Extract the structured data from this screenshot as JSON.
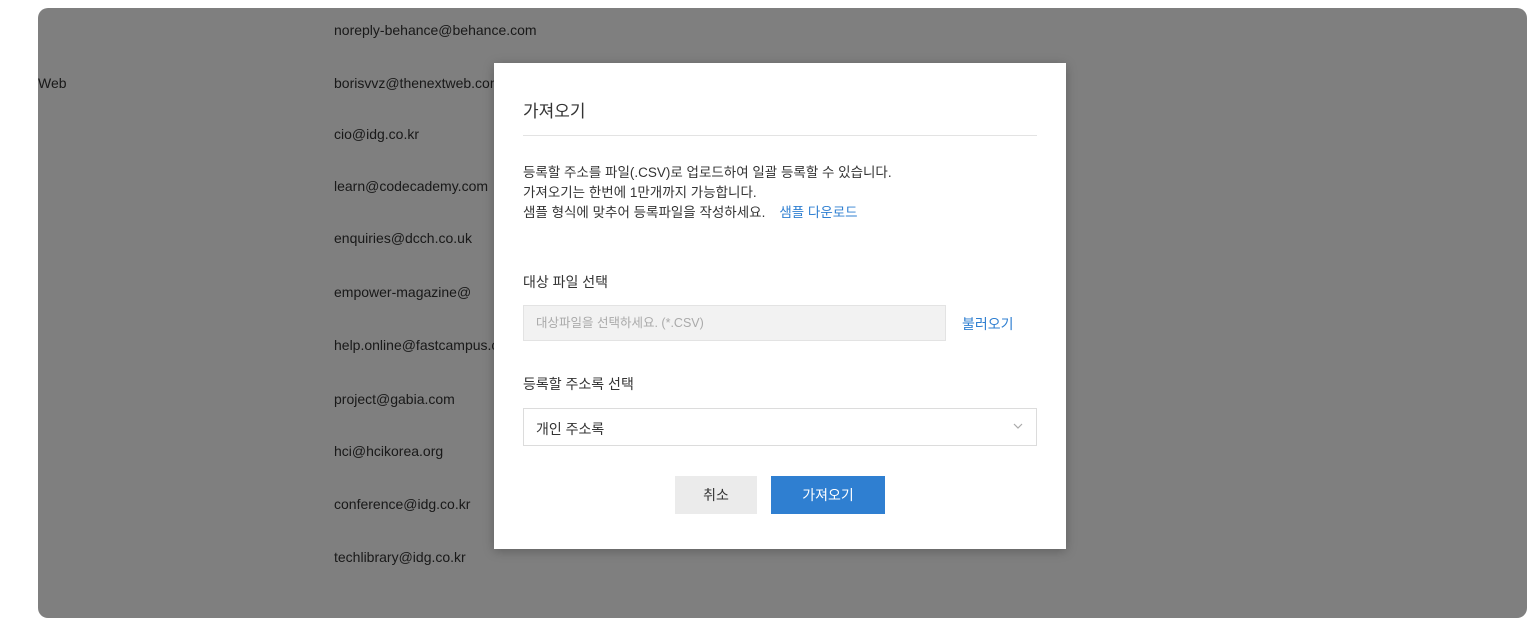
{
  "background": {
    "rows": [
      {
        "category": "",
        "email": "noreply-behance@behance.com"
      },
      {
        "category": "Web",
        "email": "borisvvz@thenextweb.com"
      },
      {
        "category": "",
        "email": "cio@idg.co.kr"
      },
      {
        "category": "",
        "email": "learn@codecademy.com"
      },
      {
        "category": "",
        "email": "enquiries@dcch.co.uk"
      },
      {
        "category": "",
        "email": "empower-magazine@"
      },
      {
        "category": "",
        "email": "help.online@fastcampus.co.kr"
      },
      {
        "category": "",
        "email": "project@gabia.com"
      },
      {
        "category": "",
        "email": "hci@hcikorea.org"
      },
      {
        "category": "",
        "email": "conference@idg.co.kr"
      },
      {
        "category": "",
        "email": "techlibrary@idg.co.kr"
      }
    ]
  },
  "modal": {
    "title": "가져오기",
    "description": {
      "line1": "등록할 주소를 파일(.CSV)로 업로드하여 일괄 등록할 수 있습니다.",
      "line2": "가져오기는 한번에 1만개까지 가능합니다.",
      "line3": "샘플 형식에 맞추어 등록파일을 작성하세요.",
      "sample_link": "샘플 다운로드"
    },
    "file_section": {
      "label": "대상 파일 선택",
      "placeholder": "대상파일을 선택하세요. (*.CSV)",
      "load_label": "불러오기"
    },
    "addressbook_section": {
      "label": "등록할 주소록 선택",
      "selected": "개인 주소록",
      "chevron_icon": "chevron-down-icon"
    },
    "buttons": {
      "cancel": "취소",
      "import": "가져오기"
    }
  },
  "colors": {
    "accent": "#2f7fd1",
    "overlay": "rgba(0,0,0,0.5)"
  }
}
